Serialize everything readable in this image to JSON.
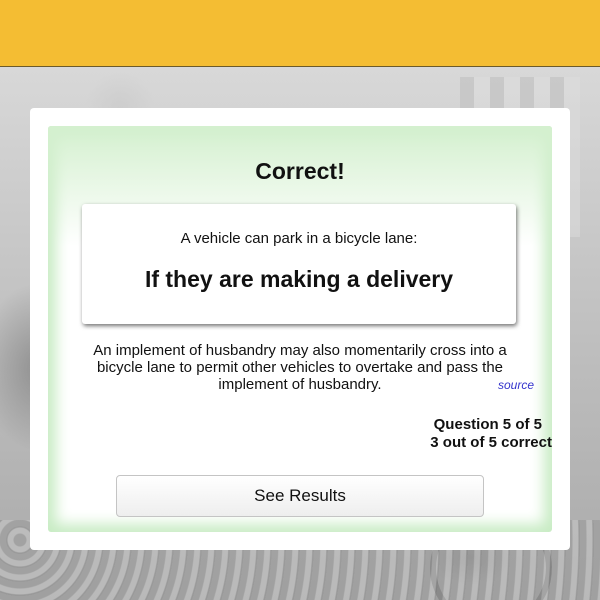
{
  "quiz": {
    "result_title": "Correct!",
    "question": "A vehicle can park in a bicycle lane:",
    "answer": "If they are making a delivery",
    "explanation": "An implement of husbandry may also momentarily cross into a bicycle lane to permit other vehicles to overtake and pass the implement of husbandry.",
    "source_label": "source",
    "progress_question": "Question 5 of 5",
    "progress_score": "3 out of 5 correct",
    "results_button_label": "See Results"
  },
  "colors": {
    "top_bar": "#f4bd33",
    "panel_glow": "#c8ecc4",
    "link": "#3333cc"
  }
}
